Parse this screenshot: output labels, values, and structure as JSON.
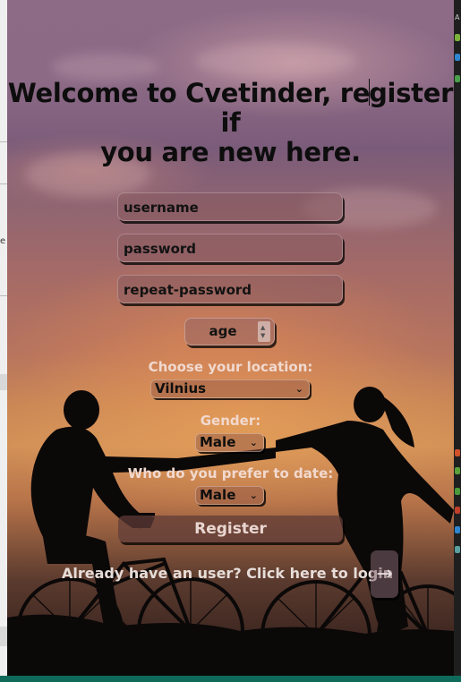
{
  "heading": {
    "line1_before_caret": "Welcome to Cvetinder, re",
    "line1_after_caret": "gister if",
    "line2": "you are new here."
  },
  "form": {
    "username_placeholder": "username",
    "password_placeholder": "password",
    "repeat_password_placeholder": "repeat-password",
    "age_placeholder": "age",
    "location_label": "Choose your location:",
    "location_value": "Vilnius",
    "gender_label": "Gender:",
    "gender_value": "Male",
    "preference_label": "Who do you prefer to date:",
    "preference_value": "Male",
    "register_label": "Register"
  },
  "login": {
    "prompt": "Already have an user? Click here to login",
    "arrow": "→"
  },
  "side": {
    "left_glyph": "e",
    "right_top_glyph": "A"
  },
  "colors": {
    "bottom_bar": "#0f6a5a"
  }
}
